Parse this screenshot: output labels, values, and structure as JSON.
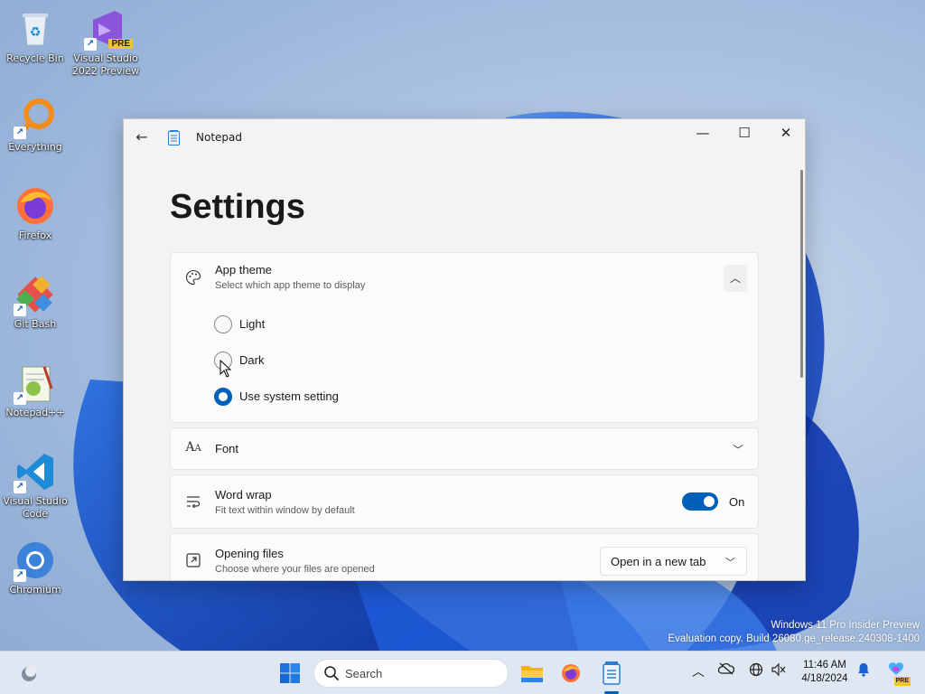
{
  "desktop": {
    "icons": [
      {
        "label": "Recycle Bin"
      },
      {
        "label": "Visual Studio 2022 Preview",
        "badge": "PRE"
      },
      {
        "label": "Everything"
      },
      {
        "label": "Firefox"
      },
      {
        "label": "Git Bash"
      },
      {
        "label": "Notepad++"
      },
      {
        "label": "Visual Studio Code"
      },
      {
        "label": "Chromium"
      }
    ],
    "watermark": {
      "line1": "Windows 11 Pro Insider Preview",
      "line2": "Evaluation copy. Build 26080.ge_release.240308-1400"
    }
  },
  "window": {
    "app_title": "Notepad",
    "back_glyph": "←",
    "minimize_glyph": "—",
    "maximize_glyph": "☐",
    "close_glyph": "✕",
    "page_title": "Settings",
    "accent": "#005fb8",
    "app_theme": {
      "heading": "App theme",
      "description": "Select which app theme to display",
      "expanded": true,
      "options": [
        {
          "label": "Light",
          "selected": false
        },
        {
          "label": "Dark",
          "selected": false
        },
        {
          "label": "Use system setting",
          "selected": true
        }
      ]
    },
    "font": {
      "heading": "Font"
    },
    "word_wrap": {
      "heading": "Word wrap",
      "description": "Fit text within window by default",
      "state_label": "On",
      "enabled": true
    },
    "opening_files": {
      "heading": "Opening files",
      "description": "Choose where your files are opened",
      "selected_option": "Open in a new tab"
    }
  },
  "taskbar": {
    "search_placeholder": "Search",
    "pinned": [
      "widgets-icon",
      "start-icon",
      "file-explorer-icon",
      "firefox-icon",
      "notepad-icon"
    ],
    "clock": {
      "time": "11:46 AM",
      "date": "4/18/2024"
    },
    "copilot_badge": "PRE"
  }
}
